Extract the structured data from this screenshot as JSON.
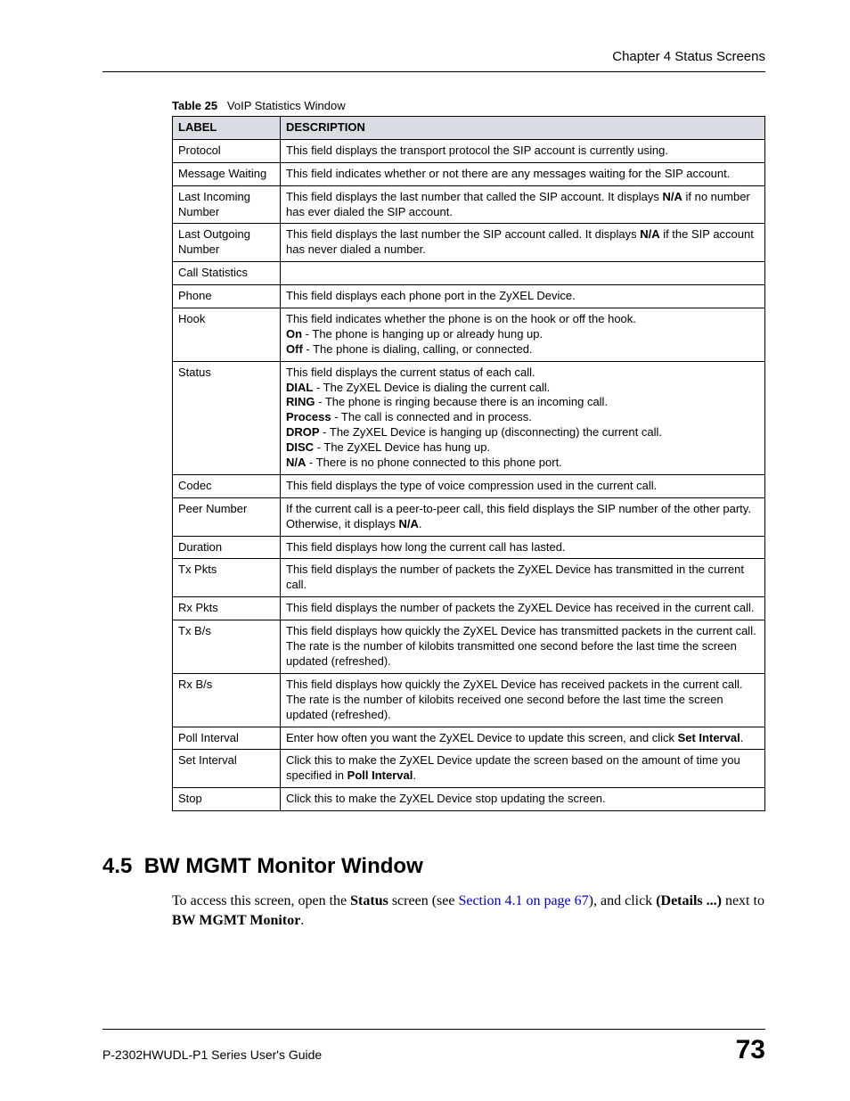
{
  "header": {
    "chapter": "Chapter 4 Status Screens"
  },
  "table": {
    "caption_label": "Table 25",
    "caption_text": "VoIP Statistics Window",
    "head": {
      "c1": "LABEL",
      "c2": "DESCRIPTION"
    },
    "rows": {
      "r0": {
        "label": "Protocol",
        "desc": "This field displays the transport protocol the SIP account is currently using."
      },
      "r1": {
        "label": "Message Waiting",
        "desc": "This field indicates whether or not there are any messages waiting for the SIP account."
      },
      "r2": {
        "label": "Last Incoming Number",
        "desc_a": "This field displays the last number that called the SIP account. It displays ",
        "desc_b": "N/A",
        "desc_c": " if no number has ever dialed the SIP account."
      },
      "r3": {
        "label": "Last Outgoing Number",
        "desc_a": "This field displays the last number the SIP account called. It displays ",
        "desc_b": "N/A",
        "desc_c": " if the SIP account has never dialed a number."
      },
      "r4": {
        "label": "Call Statistics",
        "desc": ""
      },
      "r5": {
        "label": "Phone",
        "desc": "This field displays each phone port in the ZyXEL Device."
      },
      "r6": {
        "label": "Hook",
        "l1": "This field indicates whether the phone is on the hook or off the hook.",
        "l2b": "On",
        "l2": " - The phone is hanging up or already hung up.",
        "l3b": "Off",
        "l3": " - The phone is dialing, calling, or connected."
      },
      "r7": {
        "label": "Status",
        "l1": "This field displays the current status of each call.",
        "l2b": "DIAL",
        "l2": " - The ZyXEL Device is dialing the current call.",
        "l3b": "RING",
        "l3": " - The phone is ringing because there is an incoming call.",
        "l4b": "Process",
        "l4": " - The call is connected and in process.",
        "l5b": "DROP",
        "l5": " - The ZyXEL Device is hanging up (disconnecting) the current call.",
        "l6b": "DISC",
        "l6": " - The ZyXEL Device has hung up.",
        "l7b": "N/A",
        "l7": " - There is no phone connected to this phone port."
      },
      "r8": {
        "label": "Codec",
        "desc": "This field displays the type of voice compression used in the current call."
      },
      "r9": {
        "label": "Peer Number",
        "desc_a": "If the current call is a peer-to-peer call, this field displays the SIP number of the other party. Otherwise, it displays ",
        "desc_b": "N/A",
        "desc_c": "."
      },
      "r10": {
        "label": "Duration",
        "desc": "This field displays how long the current call has lasted."
      },
      "r11": {
        "label": "Tx Pkts",
        "desc": "This field displays the number of packets the ZyXEL Device has transmitted in the current call."
      },
      "r12": {
        "label": "Rx Pkts",
        "desc": "This field displays the number of packets the ZyXEL Device has received in the current call."
      },
      "r13": {
        "label": "Tx B/s",
        "desc": "This field displays how quickly the ZyXEL Device has transmitted packets in the current call. The rate is the number of kilobits transmitted one second before the last time the screen updated (refreshed)."
      },
      "r14": {
        "label": "Rx B/s",
        "desc": "This field displays how quickly the ZyXEL Device has received packets in the current call. The rate is the number of kilobits received one second before the last time the screen updated (refreshed)."
      },
      "r15": {
        "label": "Poll Interval",
        "desc_a": "Enter how often you want the ZyXEL Device to update this screen, and click ",
        "desc_b": "Set Interval",
        "desc_c": "."
      },
      "r16": {
        "label": "Set Interval",
        "desc_a": "Click this to make the ZyXEL Device update the screen based on the amount of time you specified in ",
        "desc_b": "Poll Interval",
        "desc_c": "."
      },
      "r17": {
        "label": "Stop",
        "desc": "Click this to make the ZyXEL Device stop updating the screen."
      }
    }
  },
  "section": {
    "number": "4.5",
    "title": "BW MGMT Monitor Window",
    "p1": "To access this screen, open the ",
    "p2_b": "Status",
    "p3": " screen (see ",
    "p4_link": "Section 4.1 on page 67",
    "p5": "), and click ",
    "p6_b": "(Details ...)",
    "p7": " next to ",
    "p8_b": "BW MGMT Monitor",
    "p9": "."
  },
  "footer": {
    "guide": "P-2302HWUDL-P1 Series User's Guide",
    "page": "73"
  }
}
